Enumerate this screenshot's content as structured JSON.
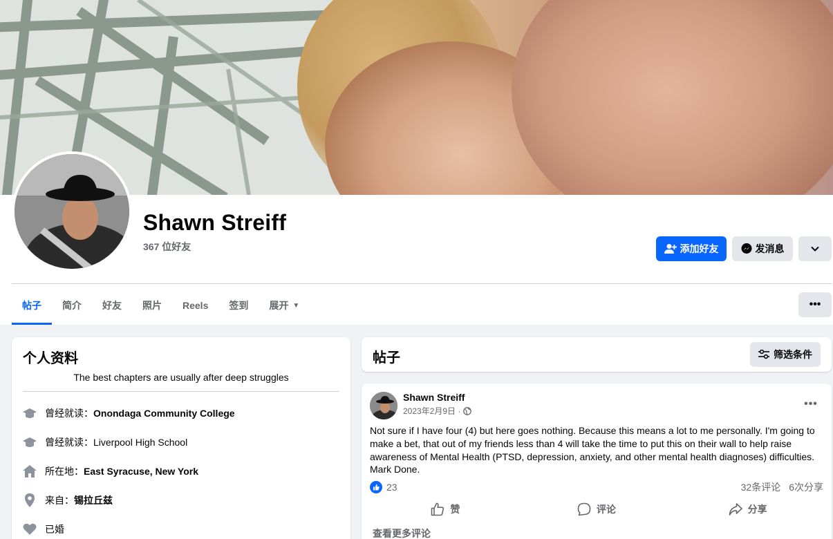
{
  "profile": {
    "name": "Shawn Streiff",
    "friends": "367 位好友",
    "add_friend": "添加好友",
    "message": "发消息"
  },
  "tabs": [
    {
      "label": "帖子",
      "active": true
    },
    {
      "label": "简介"
    },
    {
      "label": "好友"
    },
    {
      "label": "照片"
    },
    {
      "label": "Reels"
    },
    {
      "label": "签到"
    },
    {
      "label": "展开"
    }
  ],
  "intro": {
    "title": "个人资料",
    "bio": "The best chapters are usually after deep struggles",
    "rows": [
      {
        "icon": "graduation-cap-icon",
        "prefix": "曾经就读：",
        "value": "Onondaga Community College",
        "bold": true
      },
      {
        "icon": "graduation-cap-icon",
        "prefix": "曾经就读：",
        "value": "Liverpool High School",
        "bold": false
      },
      {
        "icon": "home-icon",
        "prefix": "所在地：",
        "value": "East Syracuse, New York",
        "bold": true
      },
      {
        "icon": "location-pin-icon",
        "prefix": "来自：",
        "value": "锡拉丘兹",
        "bold": true
      },
      {
        "icon": "heart-icon",
        "prefix": "已婚",
        "value": "",
        "bold": false
      }
    ]
  },
  "posts": {
    "title": "帖子",
    "filter": "筛选条件"
  },
  "post": {
    "author": "Shawn Streiff",
    "date": "2023年2月9日 ·",
    "text": "Not sure if I have four (4) but here goes nothing. Because this means a lot to me personally. I'm going to make a bet, that out of my friends less than 4 will take the time to put this on their wall to help raise awareness of Mental Health (PTSD, depression, anxiety, and other mental health diagnoses) difficulties. Mark Done.",
    "likes": "23",
    "comments": "32条评论",
    "shares": "6次分享",
    "like_label": "赞",
    "comment_label": "评论",
    "share_label": "分享",
    "more_comments": "查看更多评论"
  },
  "colors": {
    "accent": "#0866ff",
    "secondary_text": "#65676b",
    "button_gray": "#e4e6eb"
  }
}
